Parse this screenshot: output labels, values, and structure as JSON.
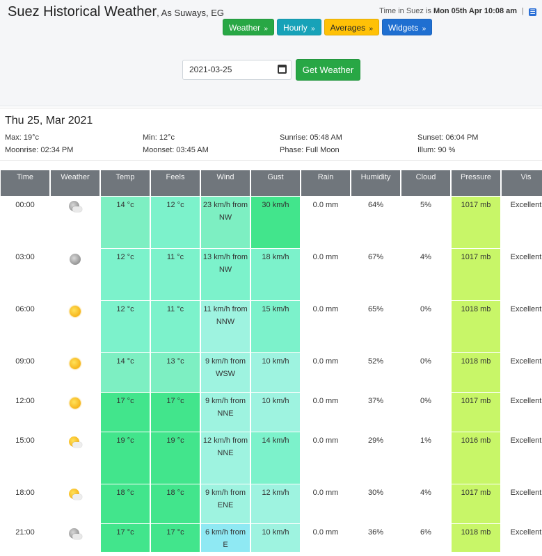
{
  "header": {
    "title": "Suez Historical Weather",
    "subtitle": ", As Suways, EG",
    "time_prefix": "Time in Suez is",
    "time_value": "Mon 05th Apr 10:08 am",
    "separator": "|",
    "rss_glyph": "☰"
  },
  "nav": [
    {
      "label": "Weather",
      "color": "green"
    },
    {
      "label": "Hourly",
      "color": "cyan"
    },
    {
      "label": "Averages",
      "color": "yellow"
    },
    {
      "label": "Widgets",
      "color": "blue"
    }
  ],
  "chevron": "»",
  "form": {
    "date_value": "2021-03-25",
    "button_label": "Get Weather"
  },
  "summary": {
    "date": "Thu 25, Mar 2021",
    "max": "Max: 19°c",
    "min": "Min: 12°c",
    "sunrise": "Sunrise: 05:48 AM",
    "sunset": "Sunset: 06:04 PM",
    "moonrise": "Moonrise: 02:34 PM",
    "moonset": "Moonset: 03:45 AM",
    "phase": "Phase: Full Moon",
    "illum": "Illum: 90 %"
  },
  "table": {
    "headers": [
      "Time",
      "Weather",
      "Temp",
      "Feels",
      "Wind",
      "Gust",
      "Rain",
      "Humidity",
      "Cloud",
      "Pressure",
      "Vis"
    ],
    "rows": [
      {
        "time": "00:00",
        "icon": "cloud-moon-icon",
        "temp": "14 °c",
        "feels": "12 °c",
        "wind": "23 km/h from NW",
        "gust": "30 km/h",
        "rain": "0.0 mm",
        "humidity": "64%",
        "cloud": "5%",
        "pressure": "1017 mb",
        "vis": "Excellent"
      },
      {
        "time": "03:00",
        "icon": "moon-icon",
        "temp": "12 °c",
        "feels": "11 °c",
        "wind": "13 km/h from NW",
        "gust": "18 km/h",
        "rain": "0.0 mm",
        "humidity": "67%",
        "cloud": "4%",
        "pressure": "1017 mb",
        "vis": "Excellent"
      },
      {
        "time": "06:00",
        "icon": "sun-icon",
        "temp": "12 °c",
        "feels": "11 °c",
        "wind": "11 km/h from NNW",
        "gust": "15 km/h",
        "rain": "0.0 mm",
        "humidity": "65%",
        "cloud": "0%",
        "pressure": "1018 mb",
        "vis": "Excellent"
      },
      {
        "time": "09:00",
        "icon": "sun-icon",
        "temp": "14 °c",
        "feels": "13 °c",
        "wind": "9 km/h from WSW",
        "gust": "10 km/h",
        "rain": "0.0 mm",
        "humidity": "52%",
        "cloud": "0%",
        "pressure": "1018 mb",
        "vis": "Excellent"
      },
      {
        "time": "12:00",
        "icon": "sun-icon",
        "temp": "17 °c",
        "feels": "17 °c",
        "wind": "9 km/h from NNE",
        "gust": "10 km/h",
        "rain": "0.0 mm",
        "humidity": "37%",
        "cloud": "0%",
        "pressure": "1017 mb",
        "vis": "Excellent"
      },
      {
        "time": "15:00",
        "icon": "cloud-sun-icon",
        "temp": "19 °c",
        "feels": "19 °c",
        "wind": "12 km/h from NNE",
        "gust": "14 km/h",
        "rain": "0.0 mm",
        "humidity": "29%",
        "cloud": "1%",
        "pressure": "1016 mb",
        "vis": "Excellent"
      },
      {
        "time": "18:00",
        "icon": "cloud-sun-icon",
        "temp": "18 °c",
        "feels": "18 °c",
        "wind": "9 km/h from ENE",
        "gust": "12 km/h",
        "rain": "0.0 mm",
        "humidity": "30%",
        "cloud": "4%",
        "pressure": "1017 mb",
        "vis": "Excellent"
      },
      {
        "time": "21:00",
        "icon": "cloud-moon-icon",
        "temp": "17 °c",
        "feels": "17 °c",
        "wind": "6 km/h from E",
        "gust": "10 km/h",
        "rain": "0.0 mm",
        "humidity": "36%",
        "cloud": "6%",
        "pressure": "1018 mb",
        "vis": "Excellent"
      }
    ]
  },
  "colors": {
    "temp_cool": "#7defc2",
    "temp_warm": "#42e58c",
    "wind_light": "#9ef3e0",
    "wind_medium": "#7cf2cb",
    "pressure": "#c8f668",
    "header_bg": "#70767c"
  }
}
